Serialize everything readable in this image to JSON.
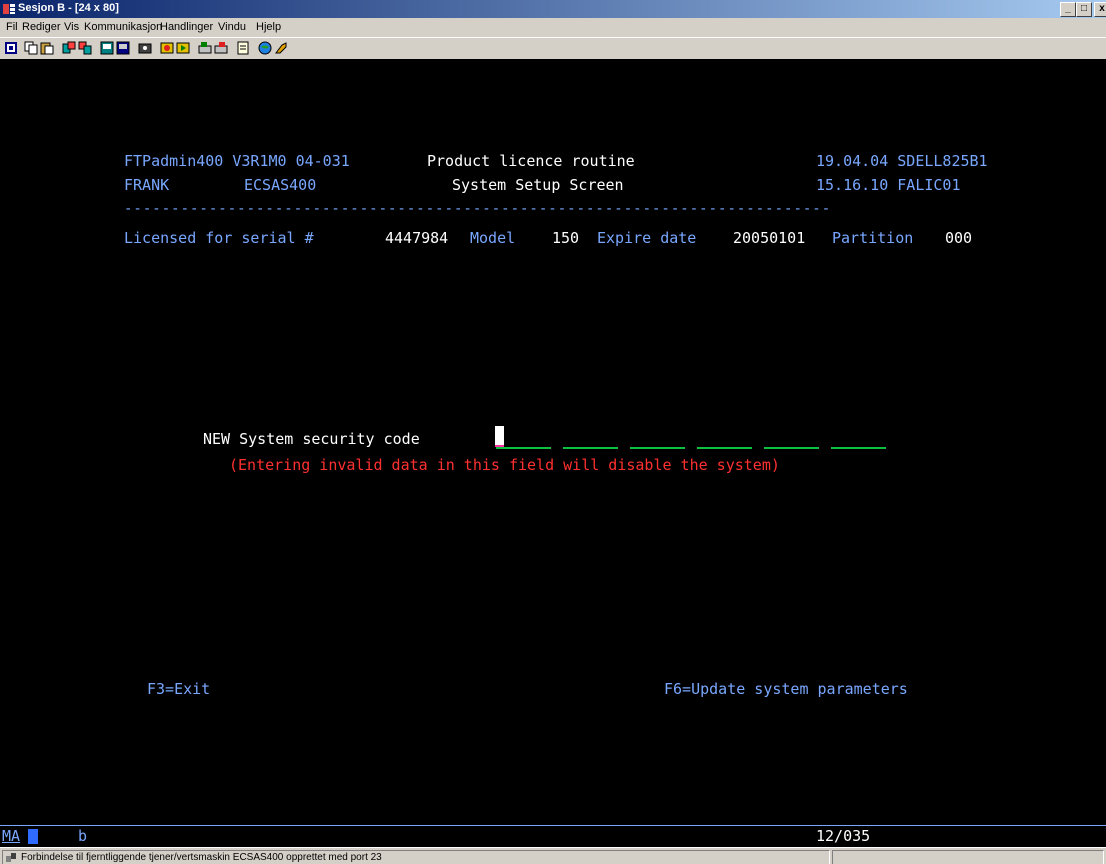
{
  "window": {
    "title": "Sesjon B - [24 x 80]",
    "minimize_glyph": "_",
    "maximize_glyph": "□",
    "close_glyph": "x"
  },
  "menu": [
    {
      "label": "Fil",
      "mnemonic": "F"
    },
    {
      "label": "Rediger",
      "mnemonic": "R"
    },
    {
      "label": "Vis",
      "mnemonic": "V"
    },
    {
      "label": "Kommunikasjon",
      "mnemonic": "K"
    },
    {
      "label": "Handlinger",
      "mnemonic": "a"
    },
    {
      "label": "Vindu",
      "mnemonic": "i"
    },
    {
      "label": "Hjelp",
      "mnemonic": "H"
    }
  ],
  "toolbar": {
    "icons": [
      "display-icon",
      "copy-icon",
      "paste-icon",
      "send-icon",
      "receive-icon",
      "screen-icon",
      "screen2-icon",
      "macro-icon",
      "record-icon",
      "play-icon",
      "keyboard-icon",
      "keypad-icon",
      "notes-icon",
      "globe-icon",
      "key-icon"
    ]
  },
  "terminal": {
    "header_left1": "FTPadmin400 V3R1M0 04-031",
    "header_center1": "Product licence routine",
    "header_right1": "19.04.04 SDELL825B1",
    "header_left2a": "FRANK",
    "header_left2b": "ECSAS400",
    "header_center2": "System Setup Screen",
    "header_right2": "15.16.10 FALIC01",
    "divider": "---------------------------------------------------------------------------",
    "license": {
      "serial_label": "Licensed for serial #",
      "serial_value": "4447984",
      "model_label": "Model",
      "model_value": "150",
      "expire_label": "Expire date",
      "expire_value": "20050101",
      "partition_label": "Partition",
      "partition_value": "000"
    },
    "security_label": "NEW System security code",
    "warning": "(Entering invalid data in this field will disable the system)",
    "f3": "F3=Exit",
    "f6": "F6=Update system parameters"
  },
  "oia": {
    "ma": "MA",
    "input_char": "b",
    "cursor_pos": "12/035"
  },
  "statusbar": {
    "message": "Forbindelse til fjerntliggende tjener/vertsmaskin ECSAS400 opprettet med port 23"
  },
  "colors": {
    "terminal_bg": "#000000",
    "field_text": "#79a7ff",
    "value_text": "#ffffff",
    "warning_text": "#ff3030",
    "input_underline": "#0fbf3f"
  }
}
